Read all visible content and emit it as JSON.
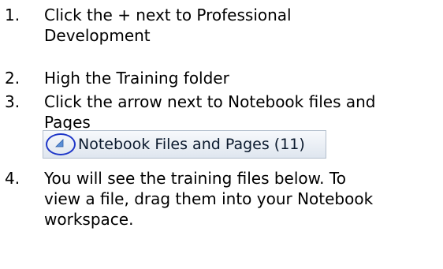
{
  "steps": [
    {
      "number": "1.",
      "lines": [
        "Click the + next to Professional",
        "Development"
      ]
    },
    {
      "number": "2.",
      "lines": [
        "High the Training folder"
      ]
    },
    {
      "number": "3.",
      "lines": [
        "Click the arrow next to Notebook files and",
        "Pages"
      ]
    },
    {
      "number": "4.",
      "lines": [
        "You will see the training files below. To",
        "view a file, drag them into your Notebook",
        "workspace."
      ]
    }
  ],
  "pane_header": {
    "label": "Notebook Files and Pages (11)",
    "icon": "expand-arrow-icon",
    "highlight_color": "#1f37c8"
  }
}
